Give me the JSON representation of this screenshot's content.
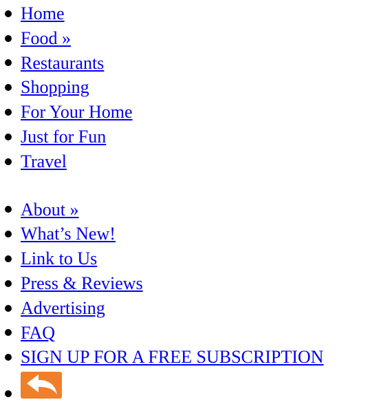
{
  "primary_nav": {
    "items": [
      {
        "label": "Home"
      },
      {
        "label": "Food »"
      },
      {
        "label": "Restaurants"
      },
      {
        "label": "Shopping"
      },
      {
        "label": "For Your Home"
      },
      {
        "label": "Just for Fun"
      },
      {
        "label": "Travel"
      }
    ]
  },
  "secondary_nav": {
    "items": [
      {
        "label": "About »"
      },
      {
        "label": "What’s New!"
      },
      {
        "label": "Link to Us"
      },
      {
        "label": "Press & Reviews"
      },
      {
        "label": "Advertising"
      },
      {
        "label": "FAQ"
      },
      {
        "label": "SIGN UP FOR A FREE SUBSCRIPTION"
      }
    ],
    "back_icon": "back-arrow-icon"
  },
  "colors": {
    "link": "#0000ee",
    "bullet": "#000000",
    "icon_background": "#f07f2a",
    "icon_arrow": "#ffffff"
  }
}
